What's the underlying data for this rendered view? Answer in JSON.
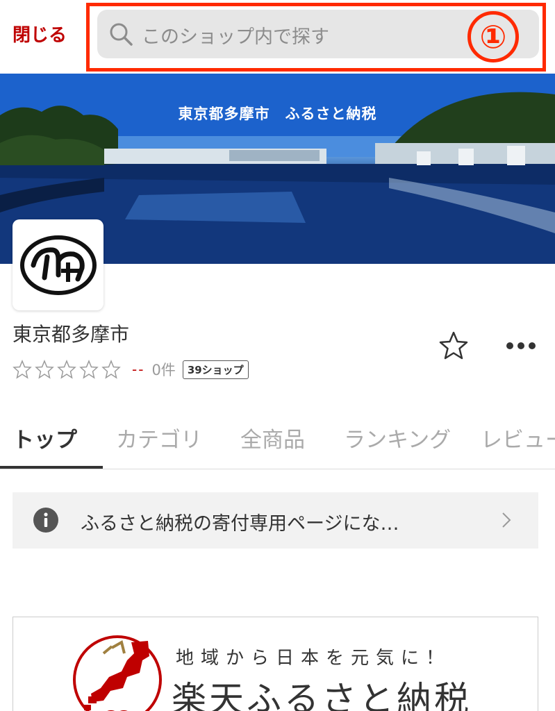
{
  "header": {
    "close_label": "閉じる",
    "search_placeholder": "このショップ内で探す",
    "annotation_marker": "①"
  },
  "banner": {
    "title": "東京都多摩市　ふるさと納税"
  },
  "shop": {
    "name": "東京都多摩市",
    "rating_stars": 0,
    "rating_max": 5,
    "rating_score": "--",
    "review_count": "0件",
    "shop_count_badge": "39ショップ"
  },
  "tabs": [
    {
      "label": "トップ",
      "active": true
    },
    {
      "label": "カテゴリ",
      "active": false
    },
    {
      "label": "全商品",
      "active": false
    },
    {
      "label": "ランキング",
      "active": false
    },
    {
      "label": "レビュー",
      "active": false
    }
  ],
  "notice": {
    "text": "ふるさと納税の寄付専用ページにな…"
  },
  "promo": {
    "tagline": "地域から日本を元気に！",
    "title": "楽天ふるさと納税"
  },
  "colors": {
    "brand_red": "#bf0000",
    "annotation_red": "#ff2a00",
    "text_dark": "#333333",
    "text_muted": "#aaaaaa"
  },
  "icons": [
    "search-icon",
    "star-outline-icon",
    "more-horizontal-icon",
    "info-icon",
    "chevron-right-icon"
  ]
}
